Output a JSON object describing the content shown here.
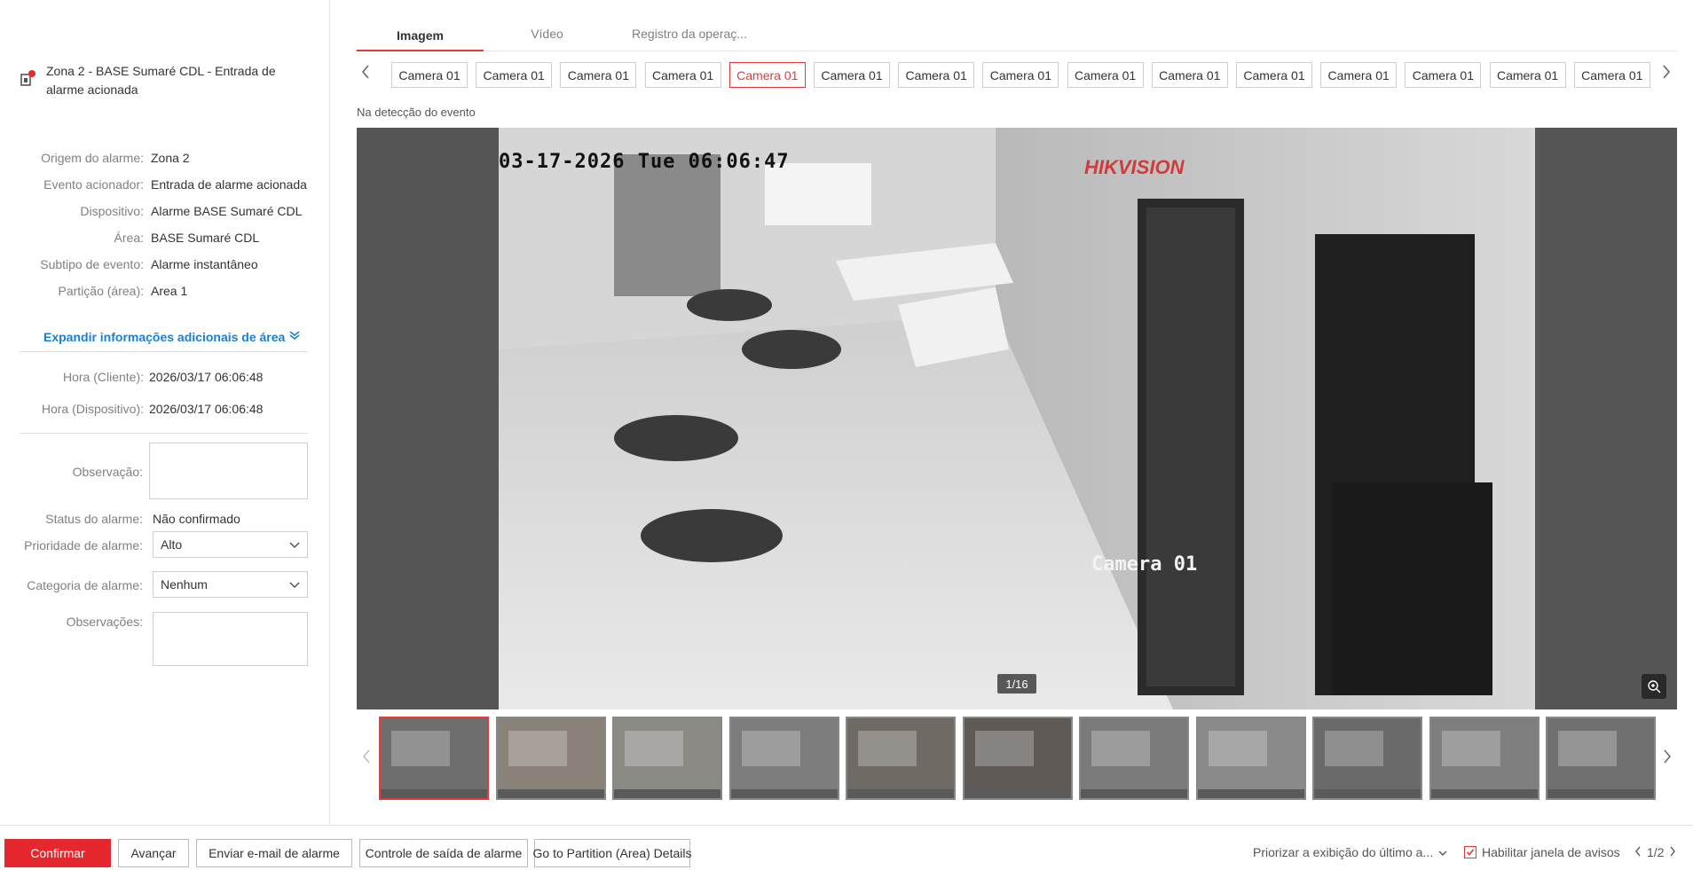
{
  "event": {
    "title": "Zona 2 - BASE Sumaré CDL - Entrada de alarme acionada"
  },
  "info": [
    {
      "label": "Origem do alarme:",
      "value": "Zona 2"
    },
    {
      "label": "Evento acionador:",
      "value": "Entrada de alarme acionada"
    },
    {
      "label": "Dispositivo:",
      "value": "Alarme BASE Sumaré CDL"
    },
    {
      "label": "Área:",
      "value": "BASE Sumaré CDL"
    },
    {
      "label": "Subtipo de evento:",
      "value": "Alarme instantâneo"
    },
    {
      "label": "Partição (área):",
      "value": "Area 1"
    }
  ],
  "expand_label": "Expandir informações adicionais de área",
  "times": [
    {
      "label": "Hora (Cliente):",
      "value": "2026/03/17 06:06:48"
    },
    {
      "label": "Hora (Dispositivo):",
      "value": "2026/03/17 06:06:48"
    }
  ],
  "form": {
    "observacao_label": "Observação:",
    "status_label": "Status do alarme:",
    "status_value": "Não confirmado",
    "priority_label": "Prioridade de alarme:",
    "priority_value": "Alto",
    "category_label": "Categoria de alarme:",
    "category_value": "Nenhum",
    "observacoes_label": "Observações:"
  },
  "tabs": [
    {
      "label": "Imagem",
      "active": true
    },
    {
      "label": "Vídeo",
      "active": false
    },
    {
      "label": "Registro da operaç...",
      "active": false
    }
  ],
  "cameras": [
    "Camera 01",
    "Camera 01",
    "Camera 01",
    "Camera 01",
    "Camera 01",
    "Camera 01",
    "Camera 01",
    "Camera 01",
    "Camera 01",
    "Camera 01",
    "Camera 01",
    "Camera 01",
    "Camera 01",
    "Camera 01",
    "Camera 01"
  ],
  "active_camera_index": 4,
  "detect_label": "Na detecção do evento",
  "viewer": {
    "osd_time": "03-17-2026 Tue 06:06:47",
    "osd_brand": "HIKVISION",
    "osd_camera": "Camera 01",
    "counter": "1/16"
  },
  "thumb_count": 11,
  "buttons": {
    "confirm": "Confirmar",
    "advance": "Avançar",
    "email": "Enviar e-mail de alarme",
    "output": "Controle de saída de alarme",
    "partition": "Go to Partition (Area) Details"
  },
  "bottom_right": {
    "priority_display": "Priorizar a exibição do último a...",
    "enable_window": "Habilitar janela de avisos",
    "page": "1/2"
  },
  "colors": {
    "accent": "#e5282e",
    "link": "#1a7fd4"
  }
}
